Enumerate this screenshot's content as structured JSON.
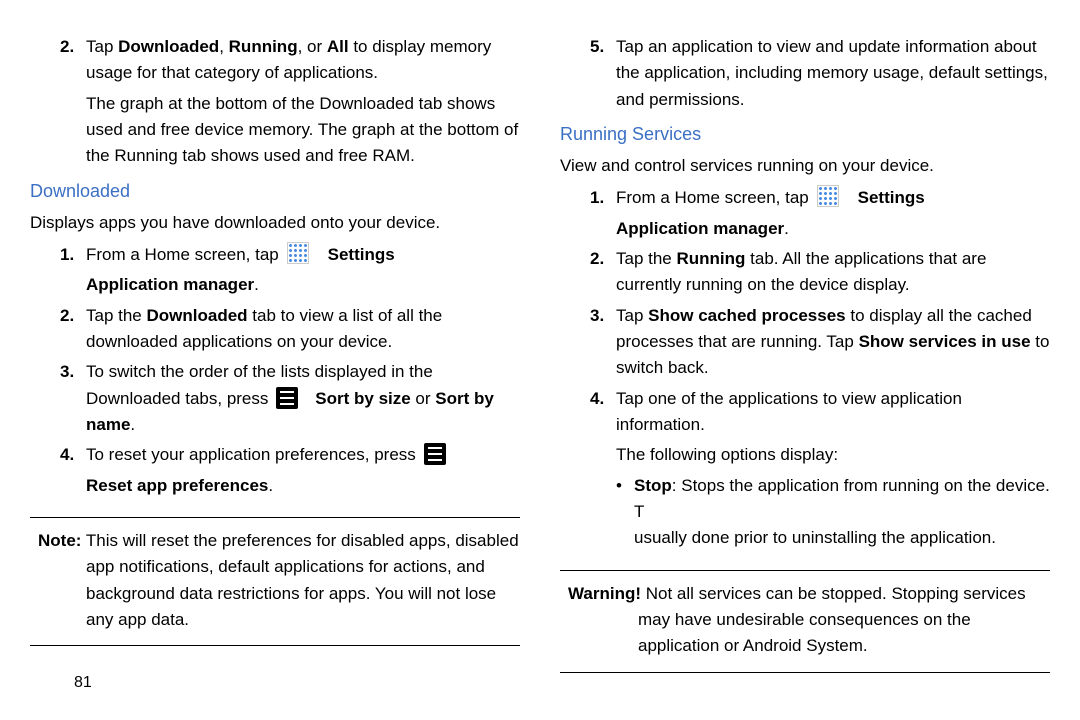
{
  "left": {
    "continuedStep2": {
      "num": "2.",
      "line1a": "Tap ",
      "line1b": "Downloaded",
      "line1c": ", ",
      "line1d": "Running",
      "line1e": ", or ",
      "line1f": "All",
      "line1g": " to display memory usage for that category of applications.",
      "para2": "The graph at the bottom of the Downloaded tab shows used and free device memory. The graph at the bottom of the Running tab shows used and free RAM."
    },
    "downloaded": {
      "heading": "Downloaded",
      "intro": "Displays apps you have downloaded onto your device.",
      "step1": {
        "num": "1.",
        "pre": "From a Home screen, tap ",
        "settings": "Settings",
        "sub": "Application manager",
        "period": "."
      },
      "step2": {
        "num": "2.",
        "a": "Tap the ",
        "b": "Downloaded",
        "c": " tab to view a list of all the downloaded applications on your device."
      },
      "step3": {
        "num": "3.",
        "a": "To switch the order of the lists displayed in the Downloaded tabs, press ",
        "b": "Sort by size",
        "c": " or ",
        "d": "Sort by name",
        "e": "."
      },
      "step4": {
        "num": "4.",
        "a": "To reset your application preferences, press ",
        "sub": "Reset app preferences",
        "period": "."
      },
      "note": {
        "label": "Note:",
        "body": " This will reset the preferences for disabled apps, disabled app notifications, default applications for actions, and background data restrictions for apps. You will not lose any app data."
      }
    }
  },
  "right": {
    "continuedStep5": {
      "num": "5.",
      "text": "Tap an application to view and update information about the application, including memory usage, default settings, and permissions."
    },
    "running": {
      "heading": "Running Services",
      "intro": "View and control services running on your device.",
      "step1": {
        "num": "1.",
        "pre": "From a Home screen, tap ",
        "settings": "Settings",
        "sub": "Application manager",
        "period": "."
      },
      "step2": {
        "num": "2.",
        "a": "Tap the ",
        "b": "Running",
        "c": " tab. All the applications that are currently running on the device display."
      },
      "step3": {
        "num": "3.",
        "a": "Tap ",
        "b": "Show cached processes",
        "c": " to display all the cached processes that are running. Tap ",
        "d": "Show services in use",
        "e": " to switch back."
      },
      "step4": {
        "num": "4.",
        "a": "Tap one of the applications to view application information.",
        "sub": "The following options display:"
      },
      "bullet1": {
        "a": "Stop",
        "b": ": Stops the application from running on the device. T",
        "c": "usually done prior to uninstalling the application."
      },
      "warning": {
        "label": "Warning!",
        "body": " Not all services can be stopped. Stopping services may have undesirable consequences on the application or Android System."
      }
    }
  },
  "pageNumber": "81"
}
